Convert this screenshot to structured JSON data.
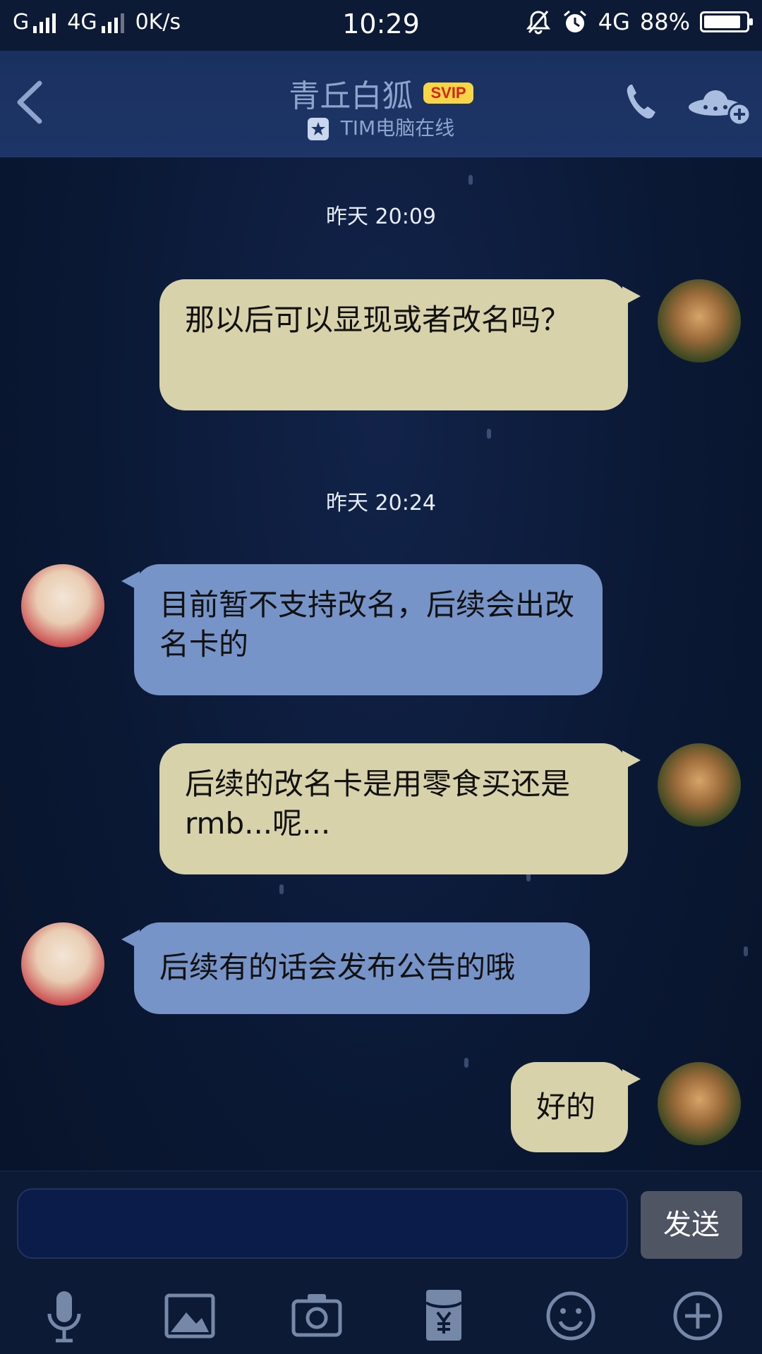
{
  "status_bar": {
    "network1": "G",
    "network2": "4G",
    "speed": "0K/s",
    "time": "10:29",
    "network3": "4G",
    "battery": "88%",
    "battery_level": 0.88
  },
  "header": {
    "title": "青丘白狐",
    "badge": "SVIP",
    "subtitle": "TIM电脑在线"
  },
  "messages": [
    {
      "type": "time",
      "text": "昨天 20:09"
    },
    {
      "type": "msg",
      "from": "me",
      "text": "那以后可以显现或者改名吗？"
    },
    {
      "type": "time",
      "text": "昨天 20:24"
    },
    {
      "type": "msg",
      "from": "them",
      "text": "目前暂不支持改名，后续会出改名卡的"
    },
    {
      "type": "msg",
      "from": "me",
      "text": "后续的改名卡是用零食买还是rmb...呢..."
    },
    {
      "type": "msg",
      "from": "them",
      "text": "后续有的话会发布公告的哦"
    },
    {
      "type": "msg",
      "from": "me",
      "text": "好的"
    }
  ],
  "input": {
    "value": "",
    "placeholder": ""
  },
  "send_label": "发送",
  "toolbar": [
    "microphone-icon",
    "image-icon",
    "camera-icon",
    "red-packet-icon",
    "emoji-icon",
    "plus-icon"
  ],
  "colors": {
    "bubble_me": "#d8d2ab",
    "bubble_them": "#7694c8",
    "header_bg": "#1d3566",
    "svip_bg": "#f6d646"
  }
}
